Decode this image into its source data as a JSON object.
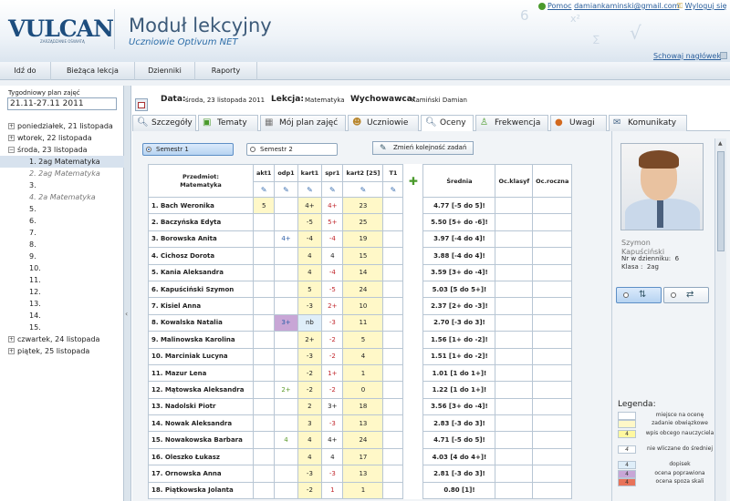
{
  "header": {
    "logo": "VULCAN",
    "logo_sub": "ZARZĄDZANIE OŚWIATĄ",
    "title": "Moduł lekcyjny",
    "subtitle": "Uczniowie Optivum NET",
    "help_label": "Pomoc",
    "user_email": "damiankaminski@gmail.com",
    "logout_label": "Wyloguj się",
    "hide_header_label": "Schowaj nagłówek"
  },
  "menu": [
    "Idź do",
    "Bieżąca lekcja",
    "Dzienniki",
    "Raporty"
  ],
  "week": {
    "label": "Tygodniowy plan zajęć",
    "value": "21.11-27.11 2011"
  },
  "tree": [
    {
      "label": "poniedziałek, 21 listopada",
      "toggle": "+"
    },
    {
      "label": "wtorek, 22 listopada",
      "toggle": "+"
    },
    {
      "label": "środa, 23 listopada",
      "toggle": "−"
    },
    {
      "label": "1. 2ag  Matematyka"
    },
    {
      "label": "2. 2ag  Matematyka"
    },
    {
      "label": "3."
    },
    {
      "label": "4. 2a  Matematyka"
    },
    {
      "label": "5."
    },
    {
      "label": "6."
    },
    {
      "label": "7."
    },
    {
      "label": "8."
    },
    {
      "label": "9."
    },
    {
      "label": "10."
    },
    {
      "label": "11."
    },
    {
      "label": "12."
    },
    {
      "label": "13."
    },
    {
      "label": "14."
    },
    {
      "label": "15."
    },
    {
      "label": "czwartek, 24 listopada",
      "toggle": "+"
    },
    {
      "label": "piątek, 25 listopada",
      "toggle": "+"
    }
  ],
  "lesson_info": {
    "date_label": "Data:",
    "date": "środa, 23 listopada 2011",
    "lesson_label": "Lekcja:",
    "lesson": "Matematyka",
    "teacher_label": "Wychowawca:",
    "teacher": "Kamiński Damian"
  },
  "tabs": [
    "Szczegóły",
    "Tematy",
    "Mój plan zajęć",
    "Uczniowie",
    "Oceny",
    "Frekwencja",
    "Uwagi",
    "Komunikaty"
  ],
  "semesters": [
    "Semestr 1",
    "Semestr 2"
  ],
  "reorder_label": "Zmień kolejność zadań",
  "table": {
    "headers": {
      "subject": "Przedmiot:",
      "subject_name": "Matematyka",
      "cols": [
        "akt1",
        "odp1",
        "kart1",
        "spr1",
        "kart2 [25]",
        "T1"
      ],
      "average": "Średnia",
      "final_class": "Oc.klasyf",
      "annual": "Oc.roczna"
    },
    "rows": [
      {
        "name": "1. Bach Weronika",
        "grades": [
          "5",
          "",
          "4+",
          "4+",
          "23",
          ""
        ],
        "avg": "4.77 [-5 do 5]!"
      },
      {
        "name": "2. Baczyńska Edyta",
        "grades": [
          "",
          "",
          "-5",
          "5+",
          "25",
          ""
        ],
        "avg": "5.50 [5+ do -6]!"
      },
      {
        "name": "3. Borowska Anita",
        "grades": [
          "",
          "4+",
          "-4",
          "-4",
          "19",
          ""
        ],
        "avg": "3.97 [-4 do 4]!"
      },
      {
        "name": "4. Cichosz Dorota",
        "grades": [
          "",
          "",
          "4",
          "4",
          "15",
          ""
        ],
        "avg": "3.88 [-4 do 4]!"
      },
      {
        "name": "5. Kania Aleksandra",
        "grades": [
          "",
          "",
          "4",
          "-4",
          "14",
          ""
        ],
        "avg": "3.59 [3+ do -4]!"
      },
      {
        "name": "6. Kapuściński Szymon",
        "grades": [
          "",
          "",
          "5",
          "-5",
          "24",
          ""
        ],
        "avg": "5.03 [5 do 5+]!"
      },
      {
        "name": "7. Kisiel Anna",
        "grades": [
          "",
          "",
          "-3",
          "2+",
          "10",
          ""
        ],
        "avg": "2.37 [2+ do -3]!"
      },
      {
        "name": "8. Kowalska Natalia",
        "grades": [
          "",
          "3+",
          "nb",
          "-3",
          "11",
          ""
        ],
        "avg": "2.70 [-3 do 3]!"
      },
      {
        "name": "9. Malinowska Karolina",
        "grades": [
          "",
          "",
          "2+",
          "-2",
          "5",
          ""
        ],
        "avg": "1.56 [1+ do -2]!"
      },
      {
        "name": "10. Marciniak Lucyna",
        "grades": [
          "",
          "",
          "-3",
          "-2",
          "4",
          ""
        ],
        "avg": "1.51 [1+ do -2]!"
      },
      {
        "name": "11. Mazur Lena",
        "grades": [
          "",
          "",
          "-2",
          "1+",
          "1",
          ""
        ],
        "avg": "1.01 [1 do 1+]!"
      },
      {
        "name": "12. Mątowska Aleksandra",
        "grades": [
          "",
          "2+",
          "-2",
          "-2",
          "0",
          ""
        ],
        "avg": "1.22 [1 do 1+]!"
      },
      {
        "name": "13. Nadolski Piotr",
        "grades": [
          "",
          "",
          "2",
          "3+",
          "18",
          ""
        ],
        "avg": "3.56 [3+ do -4]!"
      },
      {
        "name": "14. Nowak Aleksandra",
        "grades": [
          "",
          "",
          "3",
          "-3",
          "13",
          ""
        ],
        "avg": "2.83 [-3 do 3]!"
      },
      {
        "name": "15. Nowakowska Barbara",
        "grades": [
          "",
          "4",
          "4",
          "4+",
          "24",
          ""
        ],
        "avg": "4.71 [-5 do 5]!"
      },
      {
        "name": "16. Oleszko Łukasz",
        "grades": [
          "",
          "",
          "4",
          "4",
          "17",
          ""
        ],
        "avg": "4.03 [4 do 4+]!"
      },
      {
        "name": "17. Ornowska Anna",
        "grades": [
          "",
          "",
          "-3",
          "-3",
          "13",
          ""
        ],
        "avg": "2.81 [-3 do 3]!"
      },
      {
        "name": "18. Piątkowska Jolanta",
        "grades": [
          "",
          "",
          "-2",
          "1",
          "1",
          ""
        ],
        "avg": "0.80 [1]!"
      }
    ]
  },
  "student": {
    "first": "Szymon",
    "last": "Kapuściński",
    "number_label": "Nr w dzienniku:",
    "number": "6",
    "class_label": "Klasa :",
    "class": "2ag"
  },
  "legend": {
    "title": "Legenda:",
    "items": [
      {
        "swatch": "",
        "text": "miejsce na ocenę",
        "color": "#ffffff"
      },
      {
        "swatch": "",
        "text": "zadanie obwiązkowe",
        "color": "#fff8c8"
      },
      {
        "swatch": "4",
        "text": "wpis obcego nauczyciela",
        "color": "#fff8a0"
      },
      {
        "swatch": "4",
        "text": "nie wliczane do średniej",
        "color": "#ffffff"
      },
      {
        "swatch": "4",
        "text": "dopisek",
        "color": "#dfeef9"
      },
      {
        "swatch": "4",
        "text": "ocena poprawiona",
        "color": "#c8a6d6"
      },
      {
        "swatch": "4",
        "text": "ocena spoza skali",
        "color": "#e8735a"
      }
    ]
  }
}
